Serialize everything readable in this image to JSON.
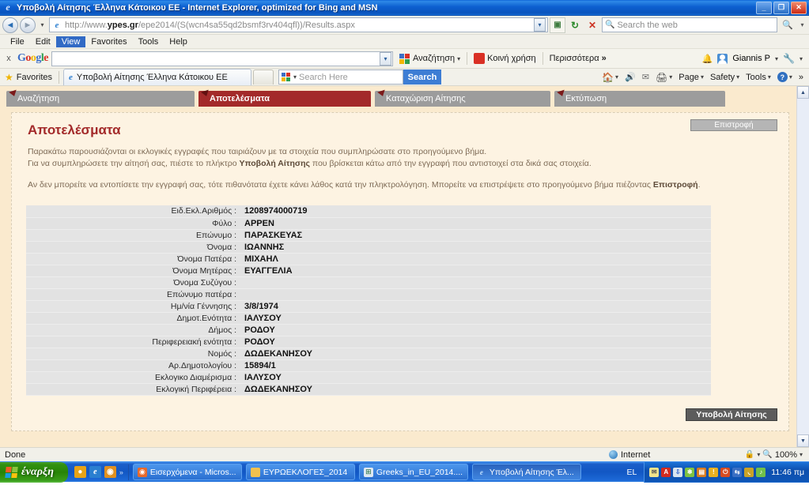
{
  "window": {
    "title": "Υποβολή Αίτησης Έλληνα Κάτοικου ΕΕ - Internet Explorer, optimized for Bing and MSN",
    "icon": "ie-icon",
    "minimize": "_",
    "maximize": "❐",
    "close": "✕"
  },
  "address_bar": {
    "back_icon": "back-arrow-icon",
    "forward_icon": "forward-arrow-icon",
    "history_caret": "▾",
    "favicon": "ie-icon",
    "url_prefix": "http://www.",
    "url_domain": "ypes.gr",
    "url_suffix": "/epe2014/(S(wcn4sa55qd2bsmf3rv404qfl))/Results.aspx",
    "url_full": "http://www.ypes.gr/epe2014/(S(wcn4sa55qd2bsmf3rv404qfl))/Results.aspx",
    "dropdown_caret": "▾",
    "compat_icon": "compatibility-view-icon",
    "refresh_icon": "↻",
    "stop_icon": "✕",
    "search_placeholder": "Search the web",
    "search_icon": "magnifier-icon",
    "search_caret": "▾"
  },
  "menu_bar": {
    "items": [
      {
        "label": "File",
        "selected": false
      },
      {
        "label": "Edit",
        "selected": false
      },
      {
        "label": "View",
        "selected": true
      },
      {
        "label": "Favorites",
        "selected": false
      },
      {
        "label": "Tools",
        "selected": false
      },
      {
        "label": "Help",
        "selected": false
      }
    ]
  },
  "google_toolbar": {
    "close_label": "x",
    "logo": [
      "G",
      "o",
      "o",
      "g",
      "l",
      "e"
    ],
    "query": "",
    "dropdown_caret": "▾",
    "search_label": "Αναζήτηση",
    "share_label": "Κοινή χρήση",
    "more_label": "Περισσότερα",
    "more_chevron": "»",
    "caret": "▾",
    "bell_icon": "bell-icon",
    "user_name": "Giannis P",
    "wrench_icon": "wrench-icon"
  },
  "favorites_bar": {
    "favorites_label": "Favorites",
    "star_icon": "star-icon",
    "tab_title": "Υποβολή Αίτησης Έλληνα Κάτοικου ΕΕ",
    "tab_icon": "ie-icon",
    "new_tab_label": "",
    "search_placeholder": "Search Here",
    "search_button": "Search",
    "commands": [
      {
        "label": "",
        "icon": "home-icon",
        "caret": "▾"
      },
      {
        "label": "",
        "icon": "rss-icon",
        "caret": ""
      },
      {
        "label": "",
        "icon": "mail-icon",
        "caret": ""
      },
      {
        "label": "",
        "icon": "print-icon",
        "caret": "▾"
      },
      {
        "label": "Page",
        "icon": "",
        "caret": "▾"
      },
      {
        "label": "Safety",
        "icon": "",
        "caret": "▾"
      },
      {
        "label": "Tools",
        "icon": "",
        "caret": "▾"
      },
      {
        "label": "",
        "icon": "help-icon",
        "caret": "▾"
      }
    ],
    "overflow_chevron": "»"
  },
  "app": {
    "tabs": [
      {
        "label": "Αναζήτηση",
        "active": false
      },
      {
        "label": "Αποτελέσματα",
        "active": true
      },
      {
        "label": "Καταχώριση Αίτησης",
        "active": false
      },
      {
        "label": "Εκτύπωση",
        "active": false
      }
    ],
    "title": "Αποτελέσματα",
    "back_button": "Επιστροφή",
    "info_line1": "Παρακάτω παρουσιάζονται οι εκλογικές εγγραφές που ταιριάζουν με τα στοιχεία που συμπληρώσατε στο προηγούμενο βήμα.",
    "info_line2_a": "Για να συμπληρώσετε την αίτησή σας, πιέστε το πλήκτρο ",
    "info_line2_b": "Υποβολή Αίτησης",
    "info_line2_c": " που βρίσκεται κάτω από την εγγραφή που αντιστοιχεί στα δικά σας στοιχεία.",
    "info_line3_a": "Αν δεν μπορείτε να εντοπίσετε την εγγραφή σας, τότε πιθανότατα έχετε κάνει λάθος κατά την πληκτρολόγηση. Μπορείτε να επιστρέψετε στο προηγούμενο βήμα πιέζοντας ",
    "info_line3_b": "Επιστροφή",
    "info_line3_c": ".",
    "submit_button": "Υποβολή Αίτησης",
    "record": [
      {
        "label": "Ειδ.Εκλ.Αριθμός :",
        "value": "1208974000719"
      },
      {
        "label": "Φύλο :",
        "value": "APPEN"
      },
      {
        "label": "Επώνυμο :",
        "value": "ΠΑΡΑΣΚΕΥΑΣ"
      },
      {
        "label": "Όνομα :",
        "value": "ΙΩΑΝΝΗΣ"
      },
      {
        "label": "Όνομα Πατέρα :",
        "value": "ΜΙΧΑΗΛ"
      },
      {
        "label": "Όνομα Μητέρας :",
        "value": "ΕΥΑΓΓΕΛΙΑ"
      },
      {
        "label": "Όνομα Συζύγου :",
        "value": ""
      },
      {
        "label": "Επώνυμο πατέρα :",
        "value": ""
      },
      {
        "label": "Ημ/νία Γέννησης :",
        "value": "3/8/1974"
      },
      {
        "label": "Δημοτ.Ενότητα :",
        "value": "ΙΑΛΥΣΟΥ"
      },
      {
        "label": "Δήμος :",
        "value": "ΡΟΔΟΥ"
      },
      {
        "label": "Περιφερειακή ενότητα :",
        "value": "ΡΟΔΟΥ"
      },
      {
        "label": "Νομός :",
        "value": "ΔΩΔΕΚΑΝΗΣΟΥ"
      },
      {
        "label": "Αρ.Δημοτολογίου :",
        "value": "15894/1"
      },
      {
        "label": "Εκλογικο Διαμέρισμα :",
        "value": "ΙΑΛΥΣΟΥ"
      },
      {
        "label": "Εκλογική Περιφέρεια :",
        "value": "ΔΩΔΕΚΑΝΗΣΟΥ"
      }
    ]
  },
  "scrollbar": {
    "up_arrow": "▲",
    "down_arrow": "▼"
  },
  "status_bar": {
    "status": "Done",
    "zone": "Internet",
    "zone_icon": "globe-icon",
    "lock_icon": "lock-icon",
    "lock_caret": "▾",
    "zoom_icon": "zoom-icon",
    "zoom": "100%",
    "zoom_caret": "▾"
  },
  "taskbar": {
    "start_label": "έναρξη",
    "start_icon": "windows-flag-icon",
    "quick_launch": [
      {
        "icon": "chrome-icon",
        "color": "#e8a317"
      },
      {
        "icon": "ie-icon",
        "color": "#2a7fd0"
      },
      {
        "icon": "media-icon",
        "color": "#e09020"
      }
    ],
    "quick_more": "»",
    "items": [
      {
        "label": "Εισερχόμενα - Micros...",
        "icon": "outlook-icon",
        "active": false
      },
      {
        "label": "ΕΥΡΩΕΚΛΟΓΕΣ_2014",
        "icon": "folder-icon",
        "active": false
      },
      {
        "label": "Greeks_in_EU_2014....",
        "icon": "excel-icon",
        "active": false
      },
      {
        "label": "Υποβολή Αίτησης Έλ...",
        "icon": "ie-icon",
        "active": true
      }
    ],
    "language": "EL",
    "tray_icons": [
      {
        "name": "mail-icon",
        "color": "#f2e48c",
        "glyph": "✉"
      },
      {
        "name": "acrobat-icon",
        "color": "#d42b1e",
        "glyph": "A"
      },
      {
        "name": "update-icon",
        "color": "#d9e4ef",
        "glyph": "⬇"
      },
      {
        "name": "antivirus-icon",
        "color": "#7fc241",
        "glyph": "✿"
      },
      {
        "name": "display-icon",
        "color": "#d97c20",
        "glyph": "▤"
      },
      {
        "name": "shield-icon",
        "color": "#e8b020",
        "glyph": "!"
      },
      {
        "name": "usb-icon",
        "color": "#d84b20",
        "glyph": "⏻"
      },
      {
        "name": "network-icon",
        "color": "#3a6fc4",
        "glyph": "⇄"
      },
      {
        "name": "clock-icon",
        "color": "#c9a227",
        "glyph": "◷"
      },
      {
        "name": "volume-icon",
        "color": "#6fbf4a",
        "glyph": "♪"
      }
    ],
    "clock": "11:46 πμ"
  },
  "colors": {
    "accent_red": "#a32a2a",
    "page_bg": "#faeace",
    "panel_bg": "#fdf3e2",
    "row_bg": "#e4e4e4",
    "title_blue": "#0c5fd0"
  }
}
